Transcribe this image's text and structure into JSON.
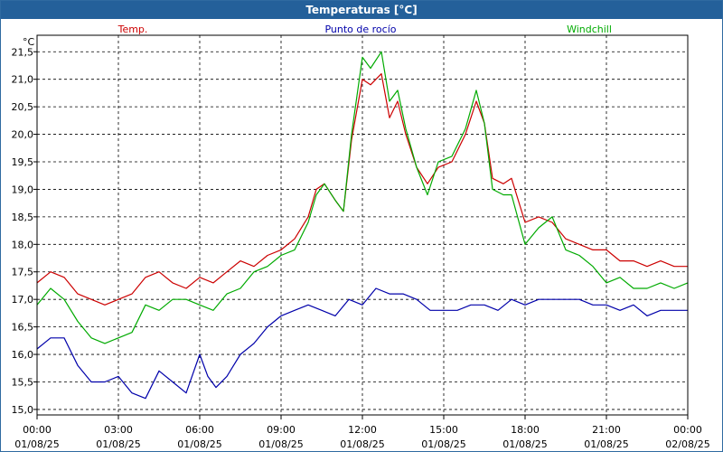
{
  "window_title": "Temperaturas [°C]",
  "chart_data": {
    "type": "line",
    "title": "Temperaturas [°C]",
    "ylabel": "°C",
    "xlabel": "",
    "ylim": [
      14.9,
      21.8
    ],
    "xlim": [
      0,
      24
    ],
    "grid": true,
    "yticks": [
      15.0,
      15.5,
      16.0,
      16.5,
      17.0,
      17.5,
      18.0,
      18.5,
      19.0,
      19.5,
      20.0,
      20.5,
      21.0,
      21.5
    ],
    "ytick_labels": [
      "15,0",
      "15,5",
      "16,0",
      "16,5",
      "17,0",
      "17,5",
      "18,0",
      "18,5",
      "19,0",
      "19,5",
      "20,0",
      "20,5",
      "21,0",
      "21,5"
    ],
    "xticks": [
      {
        "x": 0,
        "time": "00:00",
        "date": "01/08/25"
      },
      {
        "x": 3,
        "time": "03:00",
        "date": "01/08/25"
      },
      {
        "x": 6,
        "time": "06:00",
        "date": "01/08/25"
      },
      {
        "x": 9,
        "time": "09:00",
        "date": "01/08/25"
      },
      {
        "x": 12,
        "time": "12:00",
        "date": "01/08/25"
      },
      {
        "x": 15,
        "time": "15:00",
        "date": "01/08/25"
      },
      {
        "x": 18,
        "time": "18:00",
        "date": "01/08/25"
      },
      {
        "x": 21,
        "time": "21:00",
        "date": "01/08/25"
      },
      {
        "x": 24,
        "time": "00:00",
        "date": "02/08/25"
      }
    ],
    "series": [
      {
        "name": "Temp.",
        "color": "#cc0000",
        "points": [
          [
            0,
            17.3
          ],
          [
            0.5,
            17.5
          ],
          [
            1,
            17.4
          ],
          [
            1.5,
            17.1
          ],
          [
            2,
            17.0
          ],
          [
            2.5,
            16.9
          ],
          [
            3,
            17.0
          ],
          [
            3.5,
            17.1
          ],
          [
            4,
            17.4
          ],
          [
            4.5,
            17.5
          ],
          [
            5,
            17.3
          ],
          [
            5.5,
            17.2
          ],
          [
            6,
            17.4
          ],
          [
            6.5,
            17.3
          ],
          [
            7,
            17.5
          ],
          [
            7.5,
            17.7
          ],
          [
            8,
            17.6
          ],
          [
            8.5,
            17.8
          ],
          [
            9,
            17.9
          ],
          [
            9.5,
            18.1
          ],
          [
            10,
            18.5
          ],
          [
            10.3,
            19.0
          ],
          [
            10.6,
            19.1
          ],
          [
            11,
            18.8
          ],
          [
            11.3,
            18.6
          ],
          [
            11.6,
            19.9
          ],
          [
            12,
            21.0
          ],
          [
            12.3,
            20.9
          ],
          [
            12.7,
            21.1
          ],
          [
            13,
            20.3
          ],
          [
            13.3,
            20.6
          ],
          [
            13.6,
            20.0
          ],
          [
            14,
            19.4
          ],
          [
            14.4,
            19.1
          ],
          [
            14.8,
            19.4
          ],
          [
            15.3,
            19.5
          ],
          [
            15.8,
            20.0
          ],
          [
            16.2,
            20.6
          ],
          [
            16.5,
            20.2
          ],
          [
            16.8,
            19.2
          ],
          [
            17.2,
            19.1
          ],
          [
            17.5,
            19.2
          ],
          [
            18,
            18.4
          ],
          [
            18.5,
            18.5
          ],
          [
            19,
            18.4
          ],
          [
            19.5,
            18.1
          ],
          [
            20,
            18.0
          ],
          [
            20.5,
            17.9
          ],
          [
            21,
            17.9
          ],
          [
            21.5,
            17.7
          ],
          [
            22,
            17.7
          ],
          [
            22.5,
            17.6
          ],
          [
            23,
            17.7
          ],
          [
            23.5,
            17.6
          ],
          [
            24,
            17.6
          ]
        ]
      },
      {
        "name": "Punto de rocío",
        "color": "#0000aa",
        "points": [
          [
            0,
            16.1
          ],
          [
            0.5,
            16.3
          ],
          [
            1,
            16.3
          ],
          [
            1.5,
            15.8
          ],
          [
            2,
            15.5
          ],
          [
            2.5,
            15.5
          ],
          [
            3,
            15.6
          ],
          [
            3.5,
            15.3
          ],
          [
            4,
            15.2
          ],
          [
            4.5,
            15.7
          ],
          [
            5,
            15.5
          ],
          [
            5.5,
            15.3
          ],
          [
            6,
            16.0
          ],
          [
            6.3,
            15.6
          ],
          [
            6.6,
            15.4
          ],
          [
            7,
            15.6
          ],
          [
            7.5,
            16.0
          ],
          [
            8,
            16.2
          ],
          [
            8.5,
            16.5
          ],
          [
            9,
            16.7
          ],
          [
            9.5,
            16.8
          ],
          [
            10,
            16.9
          ],
          [
            10.5,
            16.8
          ],
          [
            11,
            16.7
          ],
          [
            11.5,
            17.0
          ],
          [
            12,
            16.9
          ],
          [
            12.5,
            17.2
          ],
          [
            13,
            17.1
          ],
          [
            13.5,
            17.1
          ],
          [
            14,
            17.0
          ],
          [
            14.5,
            16.8
          ],
          [
            15,
            16.8
          ],
          [
            15.5,
            16.8
          ],
          [
            16,
            16.9
          ],
          [
            16.5,
            16.9
          ],
          [
            17,
            16.8
          ],
          [
            17.5,
            17.0
          ],
          [
            18,
            16.9
          ],
          [
            18.5,
            17.0
          ],
          [
            19,
            17.0
          ],
          [
            19.5,
            17.0
          ],
          [
            20,
            17.0
          ],
          [
            20.5,
            16.9
          ],
          [
            21,
            16.9
          ],
          [
            21.5,
            16.8
          ],
          [
            22,
            16.9
          ],
          [
            22.5,
            16.7
          ],
          [
            23,
            16.8
          ],
          [
            23.5,
            16.8
          ],
          [
            24,
            16.8
          ]
        ]
      },
      {
        "name": "Windchill",
        "color": "#00aa00",
        "points": [
          [
            0,
            16.9
          ],
          [
            0.5,
            17.2
          ],
          [
            1,
            17.0
          ],
          [
            1.5,
            16.6
          ],
          [
            2,
            16.3
          ],
          [
            2.5,
            16.2
          ],
          [
            3,
            16.3
          ],
          [
            3.5,
            16.4
          ],
          [
            4,
            16.9
          ],
          [
            4.5,
            16.8
          ],
          [
            5,
            17.0
          ],
          [
            5.5,
            17.0
          ],
          [
            6,
            16.9
          ],
          [
            6.5,
            16.8
          ],
          [
            7,
            17.1
          ],
          [
            7.5,
            17.2
          ],
          [
            8,
            17.5
          ],
          [
            8.5,
            17.6
          ],
          [
            9,
            17.8
          ],
          [
            9.5,
            17.9
          ],
          [
            10,
            18.4
          ],
          [
            10.3,
            18.9
          ],
          [
            10.6,
            19.1
          ],
          [
            11,
            18.8
          ],
          [
            11.3,
            18.6
          ],
          [
            11.6,
            20.0
          ],
          [
            12,
            21.4
          ],
          [
            12.3,
            21.2
          ],
          [
            12.7,
            21.5
          ],
          [
            13,
            20.6
          ],
          [
            13.3,
            20.8
          ],
          [
            13.6,
            20.1
          ],
          [
            14,
            19.4
          ],
          [
            14.4,
            18.9
          ],
          [
            14.8,
            19.5
          ],
          [
            15.3,
            19.6
          ],
          [
            15.8,
            20.1
          ],
          [
            16.2,
            20.8
          ],
          [
            16.5,
            20.2
          ],
          [
            16.8,
            19.0
          ],
          [
            17.2,
            18.9
          ],
          [
            17.5,
            18.9
          ],
          [
            18,
            18.0
          ],
          [
            18.5,
            18.3
          ],
          [
            19,
            18.5
          ],
          [
            19.5,
            17.9
          ],
          [
            20,
            17.8
          ],
          [
            20.5,
            17.6
          ],
          [
            21,
            17.3
          ],
          [
            21.5,
            17.4
          ],
          [
            22,
            17.2
          ],
          [
            22.5,
            17.2
          ],
          [
            23,
            17.3
          ],
          [
            23.5,
            17.2
          ],
          [
            24,
            17.3
          ]
        ]
      }
    ]
  }
}
